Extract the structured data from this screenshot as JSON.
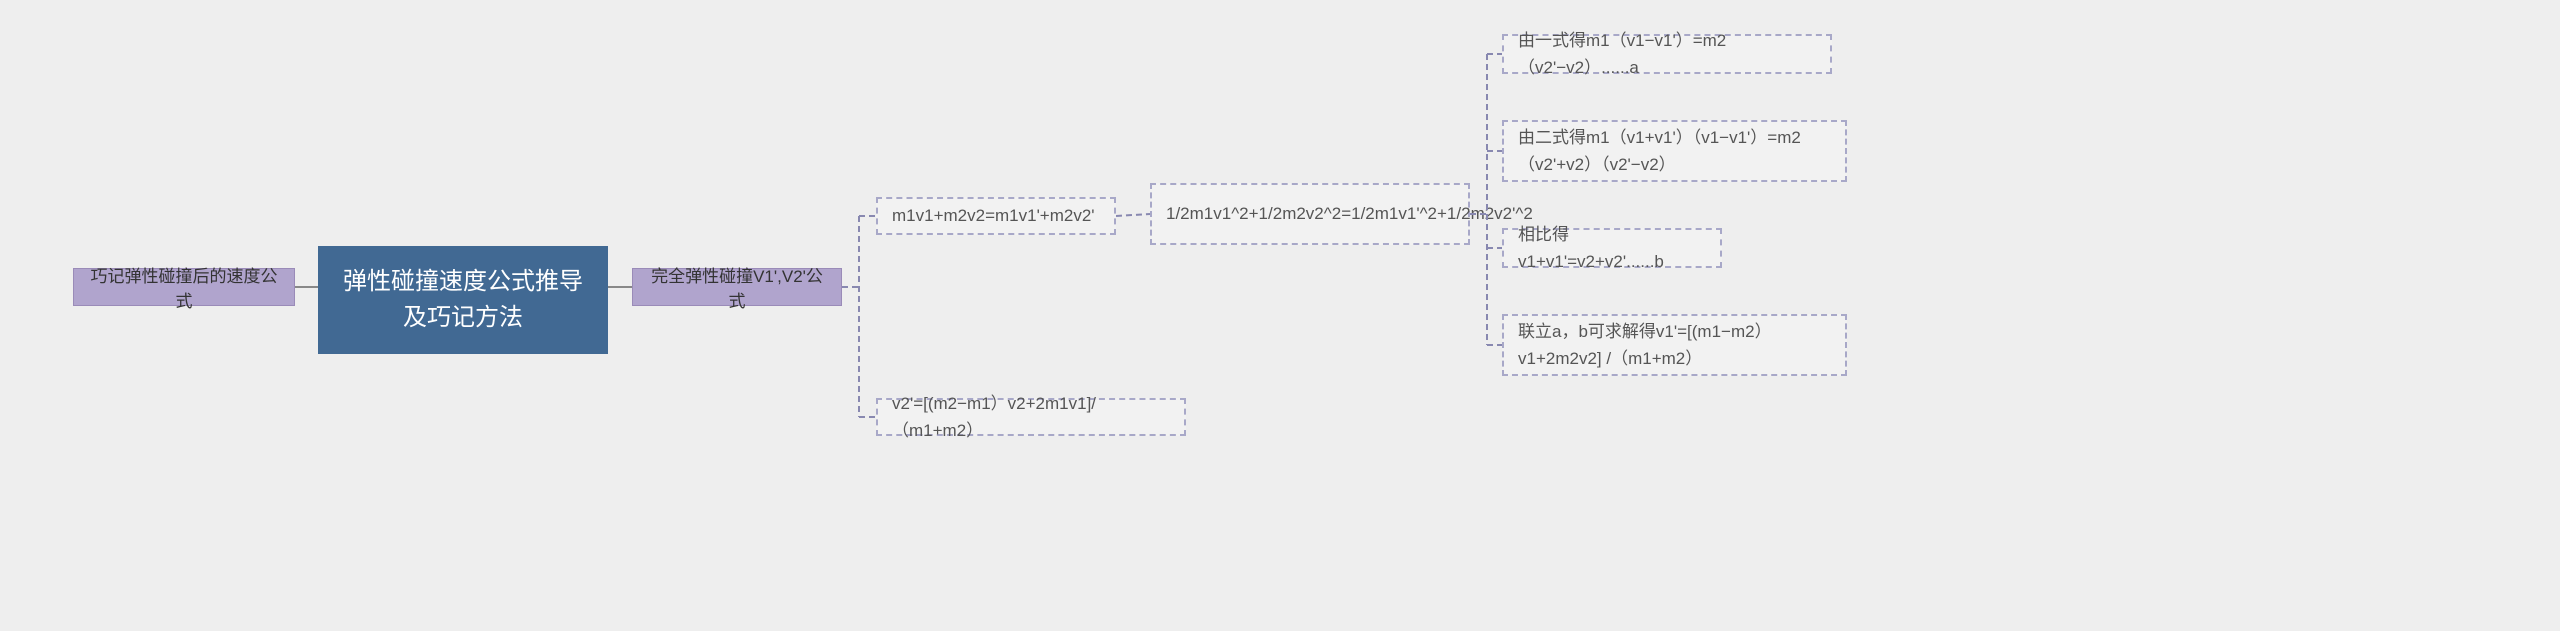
{
  "root": "弹性碰撞速度公式推导及巧记方法",
  "left1": "巧记弹性碰撞后的速度公式",
  "right1": "完全弹性碰撞V1',V2'公式",
  "eq1": "m1v1+m2v2=m1v1'+m2v2'",
  "eq2": "v2'=[(m2−m1）v2+2m1v1]/（m1+m2）",
  "eq3": "1/2m1v1^2+1/2m2v2^2=1/2m1v1'^2+1/2m2v2'^2",
  "d1": "由一式得m1（v1−v1'）=m2（v2'−v2）......a",
  "d2": "由二式得m1（v1+v1'）（v1−v1'）=m2（v2'+v2）（v2'−v2）",
  "d3": "相比得v1+v1'=v2+v2'......b",
  "d4": "联立a，b可求解得v1'=[(m1−m2）v1+2m2v2] /（m1+m2）"
}
